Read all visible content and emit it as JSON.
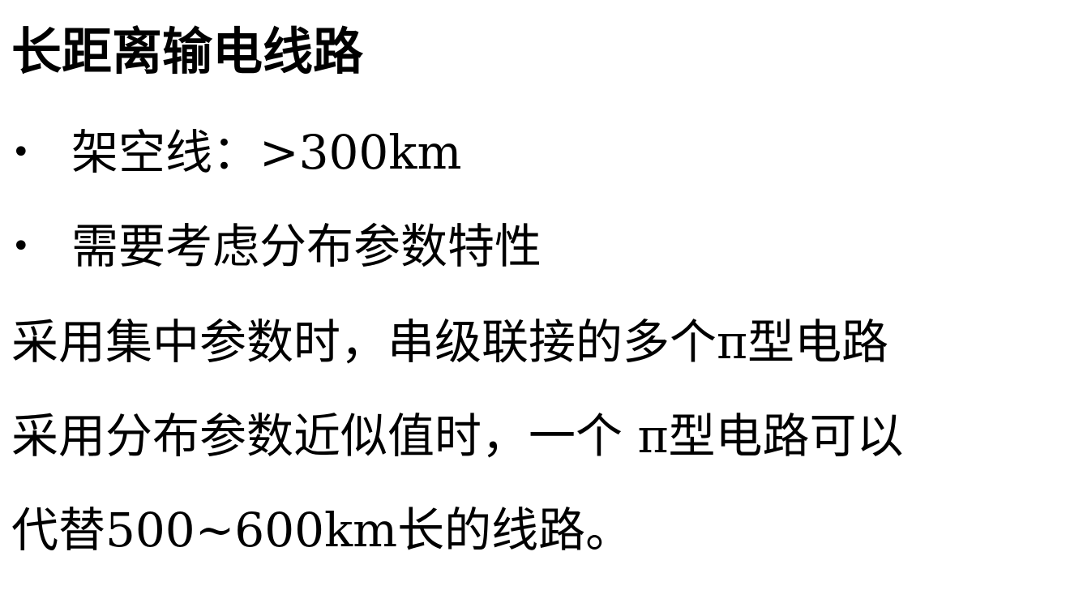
{
  "slide": {
    "title": "长距离输电线路",
    "bullets": [
      {
        "marker": "•",
        "text": "架空线：>300km"
      },
      {
        "marker": "•",
        "text": "需要考虑分布参数特性"
      }
    ],
    "paragraphs": [
      "采用集中参数时，串级联接的多个π型电路",
      "采用分布参数近似值时，一个 π型电路可以",
      "代替500~600km长的线路。"
    ]
  }
}
